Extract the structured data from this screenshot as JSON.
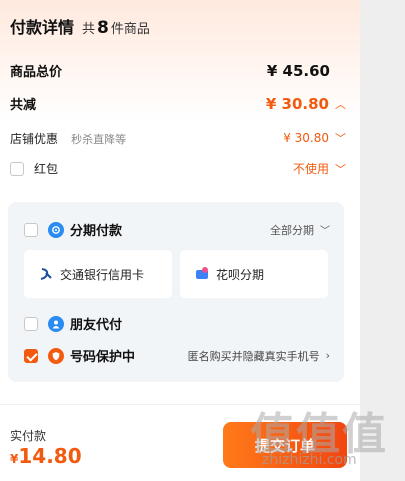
{
  "header": {
    "title": "付款详情",
    "count_prefix": "共",
    "count": "8",
    "count_suffix": "件商品"
  },
  "summary": {
    "total_label": "商品总价",
    "total_value": "¥ 45.60",
    "discount_label": "共减",
    "discount_value": "¥ 30.80",
    "shop_label": "店铺优惠",
    "shop_sub": "秒杀直降等",
    "shop_value": "¥ 30.80",
    "redpacket_label": "红包",
    "redpacket_value": "不使用"
  },
  "payment": {
    "installment_label": "分期付款",
    "installment_right": "全部分期",
    "options": [
      {
        "label": "交通银行信用卡",
        "icon": "bocom-icon"
      },
      {
        "label": "花呗分期",
        "icon": "huabei-icon"
      }
    ],
    "friend_label": "朋友代付",
    "protect_label": "号码保护中",
    "protect_right": "匿名购买并隐藏真实手机号",
    "protect_checked": true
  },
  "footer": {
    "paid_label": "实付款",
    "paid_currency": "¥",
    "paid_value": "14.80",
    "submit_label": "提交订单"
  },
  "watermark": {
    "text": "值值值",
    "sub": "zhizhizhi.com"
  },
  "colors": {
    "accent": "#f25a0f",
    "card_bg": "#f2f5f8",
    "blue": "#2a8bf2"
  }
}
